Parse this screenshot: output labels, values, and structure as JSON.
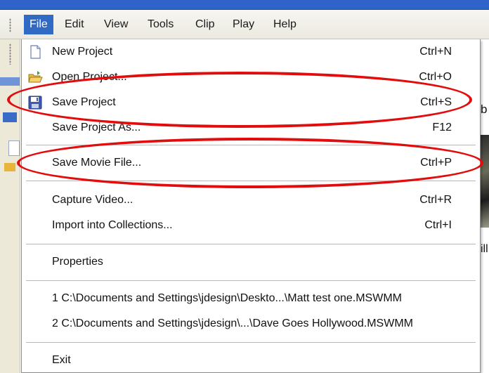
{
  "menubar": {
    "items": [
      {
        "label": "File",
        "active": true
      },
      {
        "label": "Edit"
      },
      {
        "label": "View"
      },
      {
        "label": "Tools"
      },
      {
        "label": "Clip"
      },
      {
        "label": "Play"
      },
      {
        "label": "Help"
      }
    ]
  },
  "file_menu": {
    "items": [
      {
        "label": "New Project",
        "shortcut": "Ctrl+N",
        "icon": "new-document-icon"
      },
      {
        "label": "Open Project...",
        "shortcut": "Ctrl+O",
        "icon": "open-folder-icon"
      },
      {
        "label": "Save Project",
        "shortcut": "Ctrl+S",
        "icon": "floppy-disk-icon"
      },
      {
        "label": "Save Project As...",
        "shortcut": "F12"
      },
      {
        "label": "Save Movie File...",
        "shortcut": "Ctrl+P"
      },
      {
        "label": "Capture Video...",
        "shortcut": "Ctrl+R"
      },
      {
        "label": "Import into Collections...",
        "shortcut": "Ctrl+I"
      },
      {
        "label": "Properties",
        "shortcut": ""
      },
      {
        "label": "1 C:\\Documents and Settings\\jdesign\\Deskto...\\Matt test one.MSWMM",
        "shortcut": ""
      },
      {
        "label": "2 C:\\Documents and Settings\\jdesign\\...\\Dave Goes Hollywood.MSWMM",
        "shortcut": ""
      },
      {
        "label": "Exit",
        "shortcut": ""
      }
    ]
  },
  "background_window": {
    "right_text_1": "b",
    "right_text_2": "ill"
  },
  "colors": {
    "menu_highlight": "#316ac5",
    "annotation": "#e30c0c",
    "title_bar": "#2f63c9"
  }
}
